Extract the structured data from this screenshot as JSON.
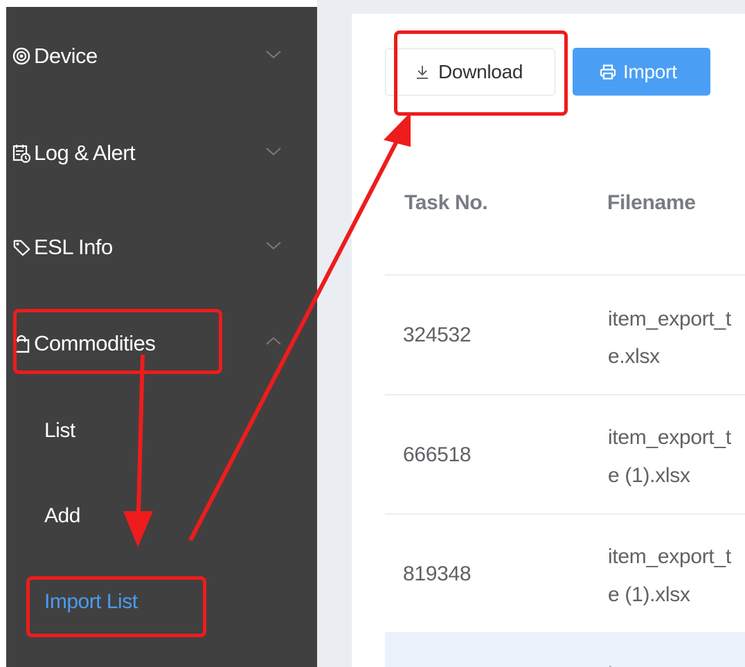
{
  "sidebar": {
    "items": [
      {
        "label": "Device",
        "icon": "radar-icon",
        "expanded": false
      },
      {
        "label": "Log & Alert",
        "icon": "calendar-clock-icon",
        "expanded": false
      },
      {
        "label": "ESL Info",
        "icon": "tag-icon",
        "expanded": false
      },
      {
        "label": "Commodities",
        "icon": "bag-icon",
        "expanded": true
      }
    ],
    "subitems": [
      {
        "label": "List"
      },
      {
        "label": "Add"
      },
      {
        "label": "Import List",
        "active": true
      }
    ]
  },
  "toolbar": {
    "download_label": "Download",
    "import_label": "Import"
  },
  "table": {
    "headers": [
      "Task No.",
      "Filename"
    ],
    "rows": [
      {
        "task_no": "324532",
        "filename_line1": "item_export_t",
        "filename_line2": "e.xlsx"
      },
      {
        "task_no": "666518",
        "filename_line1": "item_export_t",
        "filename_line2": "e (1).xlsx"
      },
      {
        "task_no": "819348",
        "filename_line1": "item_export_t",
        "filename_line2": "e (1).xlsx"
      },
      {
        "task_no": "",
        "filename_line1": "item_export_t",
        "filename_line2": ""
      }
    ]
  },
  "colors": {
    "sidebar_bg": "#404040",
    "active_link": "#4a9cf0",
    "primary_button": "#4a9ff5",
    "annotation": "#ee1c1c"
  }
}
